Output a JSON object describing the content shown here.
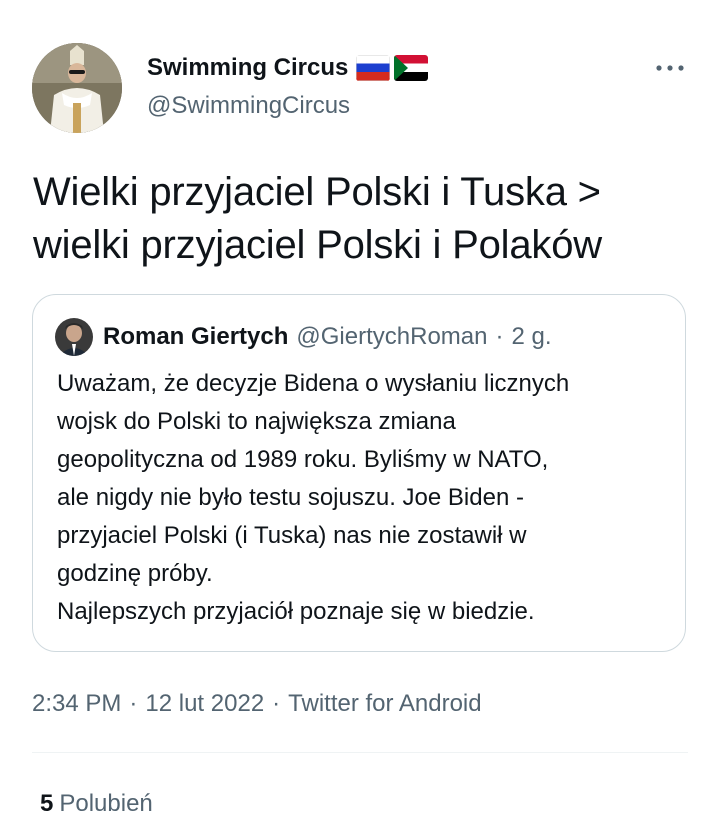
{
  "author": {
    "name": "Swimming Circus",
    "handle": "@SwimmingCircus",
    "flags": [
      "russia-flag-icon",
      "sudan-flag-icon"
    ]
  },
  "tweet": {
    "text_lines": [
      "Wielki przyjaciel Polski i Tuska >",
      "wielki przyjaciel Polski i Polaków"
    ]
  },
  "quoted": {
    "name": "Roman Giertych",
    "handle": "@GiertychRoman",
    "dot": "·",
    "time": "2 g.",
    "text_lines": [
      "Uważam, że decyzje Bidena o wysłaniu licznych",
      "wojsk do Polski to największa zmiana",
      "geopolityczna od 1989 roku. Byliśmy w NATO,",
      "ale nigdy nie było testu sojuszu. Joe Biden -",
      "przyjaciel Polski (i Tuska) nas nie zostawił w",
      "godzinę próby.",
      "Najlepszych przyjaciół poznaje się w biedzie."
    ]
  },
  "meta": {
    "time": "2:34 PM",
    "separator": "·",
    "date": "12 lut 2022",
    "source": "Twitter for Android"
  },
  "stats": {
    "likes_count": "5",
    "likes_label": "Polubień"
  },
  "colors": {
    "text_primary": "#0f1419",
    "text_secondary": "#536471",
    "border": "#cfd9de",
    "divider": "#eff3f4"
  }
}
